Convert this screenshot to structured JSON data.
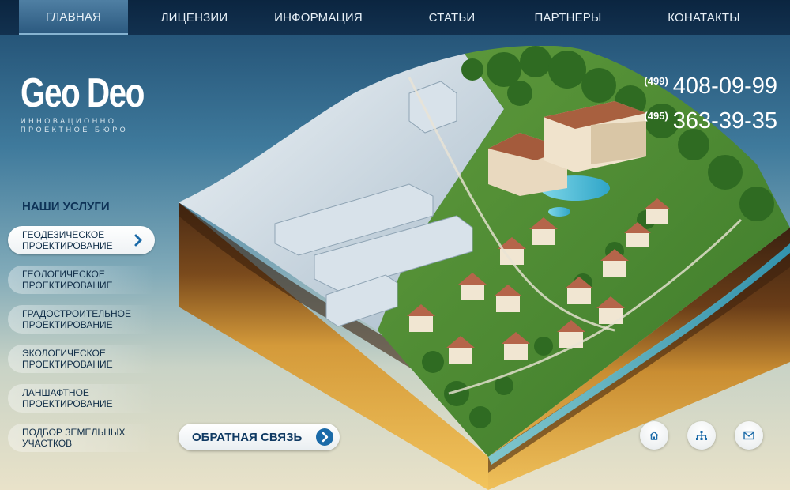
{
  "nav": {
    "items": [
      {
        "label": "ГЛАВНАЯ",
        "active": true
      },
      {
        "label": "ЛИЦЕНЗИИ",
        "active": false
      },
      {
        "label": "ИНФОРМАЦИЯ",
        "active": false
      },
      {
        "label": "СТАТЬИ",
        "active": false
      },
      {
        "label": "ПАРТНЕРЫ",
        "active": false
      },
      {
        "label": "КОНАТАКТЫ",
        "active": false
      }
    ]
  },
  "logo": {
    "title": "Geo Deo",
    "subtitle_1": "ИННОВАЦИОННО",
    "subtitle_2": "ПРОЕКТНОЕ БЮРО"
  },
  "phones": [
    {
      "code": "(499)",
      "number": "408-09-99"
    },
    {
      "code": "(495)",
      "number": "363-39-35"
    }
  ],
  "services": {
    "title": "НАШИ УСЛУГИ",
    "items": [
      {
        "line1": "ГЕОДЕЗИЧЕСКОЕ",
        "line2": "ПРОЕКТИРОВАНИЕ",
        "active": true
      },
      {
        "line1": "ГЕОЛОГИЧЕСКОЕ",
        "line2": "ПРОЕКТИРОВАНИЕ",
        "active": false
      },
      {
        "line1": "ГРАДОСТРОИТЕЛЬНОЕ",
        "line2": "ПРОЕКТИРОВАНИЕ",
        "active": false
      },
      {
        "line1": "ЭКОЛОГИЧЕСКОЕ",
        "line2": "ПРОЕКТИРОВАНИЕ",
        "active": false
      },
      {
        "line1": "ЛАНШАФТНОЕ",
        "line2": "ПРОЕКТИРОВАНИЕ",
        "active": false
      },
      {
        "line1": "ПОДБОР ЗЕМЕЛЬНЫХ",
        "line2": "УЧАСТКОВ",
        "active": false
      }
    ]
  },
  "feedback": {
    "label": "ОБРАТНАЯ СВЯЗЬ"
  },
  "icons": {
    "home": "home-icon",
    "sitemap": "sitemap-icon",
    "mail": "mail-icon"
  },
  "colors": {
    "nav_bg": "#0b2540",
    "accent": "#1a6aa8",
    "text_dark": "#13304a"
  }
}
